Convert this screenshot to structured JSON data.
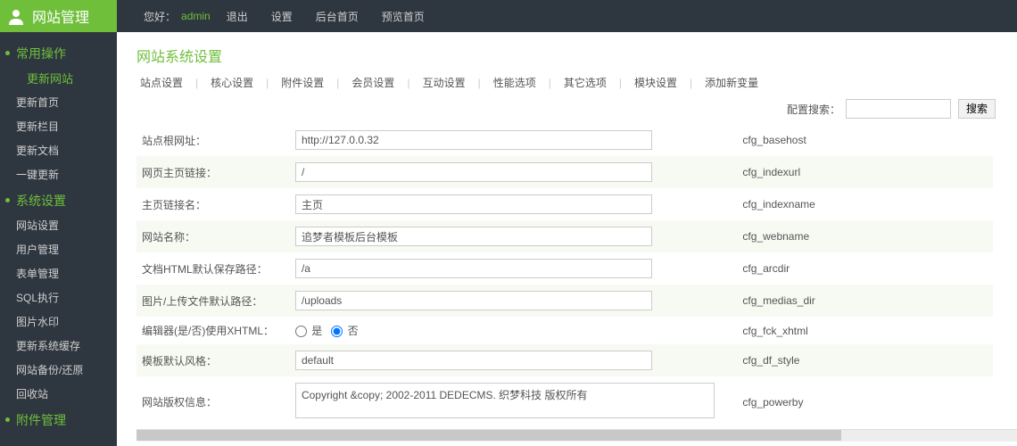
{
  "sidebarTitle": "网站管理",
  "topbar": {
    "greet": "您好：",
    "admin": "admin",
    "links": [
      "退出",
      "设置",
      "后台首页",
      "预览首页"
    ]
  },
  "sidebar": {
    "groups": [
      {
        "cat": "常用操作",
        "sub": "更新网站",
        "items": [
          "更新首页",
          "更新栏目",
          "更新文档",
          "一键更新"
        ]
      },
      {
        "cat": "系统设置",
        "sub": null,
        "items": [
          "网站设置",
          "用户管理",
          "表单管理",
          "SQL执行",
          "图片水印",
          "更新系统缓存",
          "网站备份/还原",
          "回收站"
        ]
      },
      {
        "cat": "附件管理",
        "sub": null,
        "items": []
      }
    ]
  },
  "pageTitle": "网站系统设置",
  "tabs": [
    "站点设置",
    "核心设置",
    "附件设置",
    "会员设置",
    "互动设置",
    "性能选项",
    "其它选项",
    "模块设置",
    "添加新变量"
  ],
  "search": {
    "label": "配置搜索：",
    "value": "",
    "button": "搜索"
  },
  "rows": [
    {
      "label": "站点根网址：",
      "type": "text",
      "value": "http://127.0.0.32",
      "key": "cfg_basehost"
    },
    {
      "label": "网页主页链接：",
      "type": "text",
      "value": "/",
      "key": "cfg_indexurl"
    },
    {
      "label": "主页链接名：",
      "type": "text",
      "value": "主页",
      "key": "cfg_indexname"
    },
    {
      "label": "网站名称：",
      "type": "text",
      "value": "追梦者模板后台模板",
      "key": "cfg_webname"
    },
    {
      "label": "文档HTML默认保存路径：",
      "type": "text",
      "value": "/a",
      "key": "cfg_arcdir"
    },
    {
      "label": "图片/上传文件默认路径：",
      "type": "text",
      "value": "/uploads",
      "key": "cfg_medias_dir"
    },
    {
      "label": "编辑器(是/否)使用XHTML：",
      "type": "radio",
      "value": "否",
      "opt1": "是",
      "opt2": "否",
      "key": "cfg_fck_xhtml"
    },
    {
      "label": "模板默认风格：",
      "type": "text",
      "value": "default",
      "key": "cfg_df_style"
    },
    {
      "label": "网站版权信息：",
      "type": "textarea",
      "value": "Copyright &copy; 2002-2011 DEDECMS. 织梦科技 版权所有",
      "key": "cfg_powerby"
    }
  ]
}
